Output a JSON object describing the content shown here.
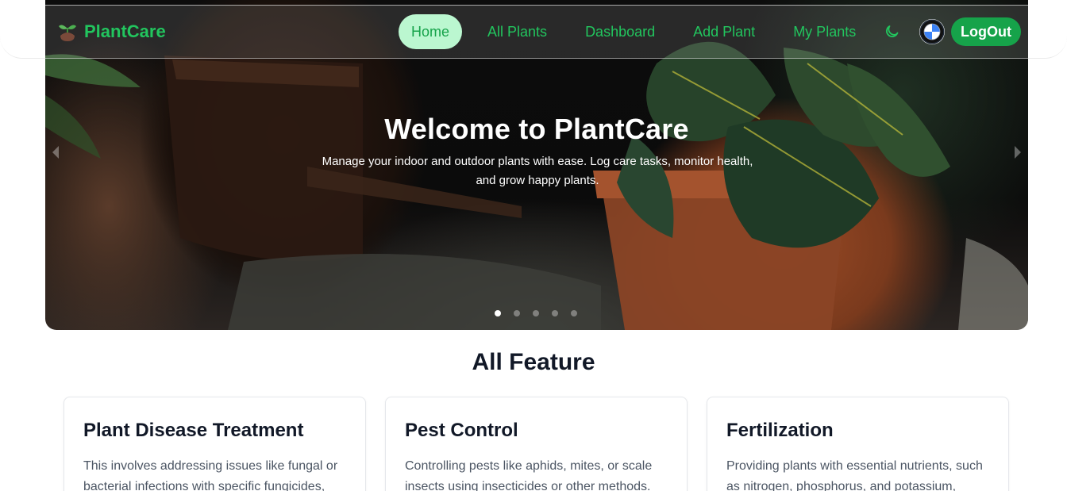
{
  "brand": {
    "name": "PlantCare",
    "accent": "#22c55e",
    "accent_dark": "#16a34a",
    "accent_light": "#bbf7d0"
  },
  "nav": {
    "items": [
      {
        "label": "Home",
        "active": true
      },
      {
        "label": "All Plants",
        "active": false
      },
      {
        "label": "Dashboard",
        "active": false
      },
      {
        "label": "Add Plant",
        "active": false
      },
      {
        "label": "My Plants",
        "active": false
      }
    ],
    "theme_icon": "moon-icon",
    "avatar_icon": "bmw-logo-avatar",
    "logout_label": "LogOut"
  },
  "hero": {
    "title": "Welcome to PlantCare",
    "subtitle": "Manage your indoor and outdoor plants with ease. Log care tasks, monitor health, and grow happy plants.",
    "slide_count": 5,
    "active_slide": 1
  },
  "features": {
    "title": "All Feature",
    "cards": [
      {
        "title": "Plant Disease Treatment",
        "text": "This involves addressing issues like fungal or bacterial infections with specific fungicides,"
      },
      {
        "title": "Pest Control",
        "text": "Controlling pests like aphids, mites, or scale insects using insecticides or other methods."
      },
      {
        "title": "Fertilization",
        "text": "Providing plants with essential nutrients, such as nitrogen, phosphorus, and potassium,"
      }
    ]
  }
}
